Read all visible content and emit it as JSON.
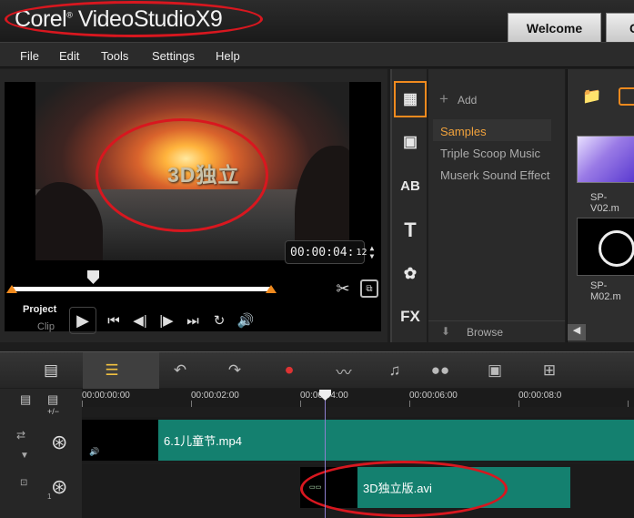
{
  "app": {
    "logo_prefix": "Corel",
    "logo_name": "VideoStudio",
    "logo_version": "X9"
  },
  "tabs": [
    {
      "label": "Welcome"
    },
    {
      "label": "C"
    }
  ],
  "menu": [
    {
      "label": "File"
    },
    {
      "label": "Edit"
    },
    {
      "label": "Tools"
    },
    {
      "label": "Settings"
    },
    {
      "label": "Help"
    }
  ],
  "preview": {
    "caption": "3D独立",
    "mode_project": "Project",
    "mode_clip": "Clip",
    "timecode": "00:00:04:",
    "timecode_frames": "12"
  },
  "library": {
    "add_label": "Add",
    "items": [
      {
        "label": "Samples",
        "selected": true
      },
      {
        "label": "Triple Scoop Music"
      },
      {
        "label": "Muserk Sound Effect"
      }
    ],
    "browse_label": "Browse",
    "thumbs": [
      {
        "caption": "SP-V02.m"
      },
      {
        "caption": "SP-M02.m"
      }
    ]
  },
  "timeline": {
    "ruler": [
      "00:00:00:00",
      "00:00:02:00",
      "00:00:04:00",
      "00:00:06:00",
      "00:00:08:0"
    ],
    "tracks": [
      {
        "clip": "6.1儿童节.mp4"
      },
      {
        "clip": "3D独立版.avi"
      }
    ],
    "track_number": "1",
    "tools_label": "+/−"
  },
  "colors": {
    "accent": "#f08a1e",
    "clip": "#14806f",
    "highlight": "#d8171f",
    "selected_text": "#f1a23c"
  }
}
